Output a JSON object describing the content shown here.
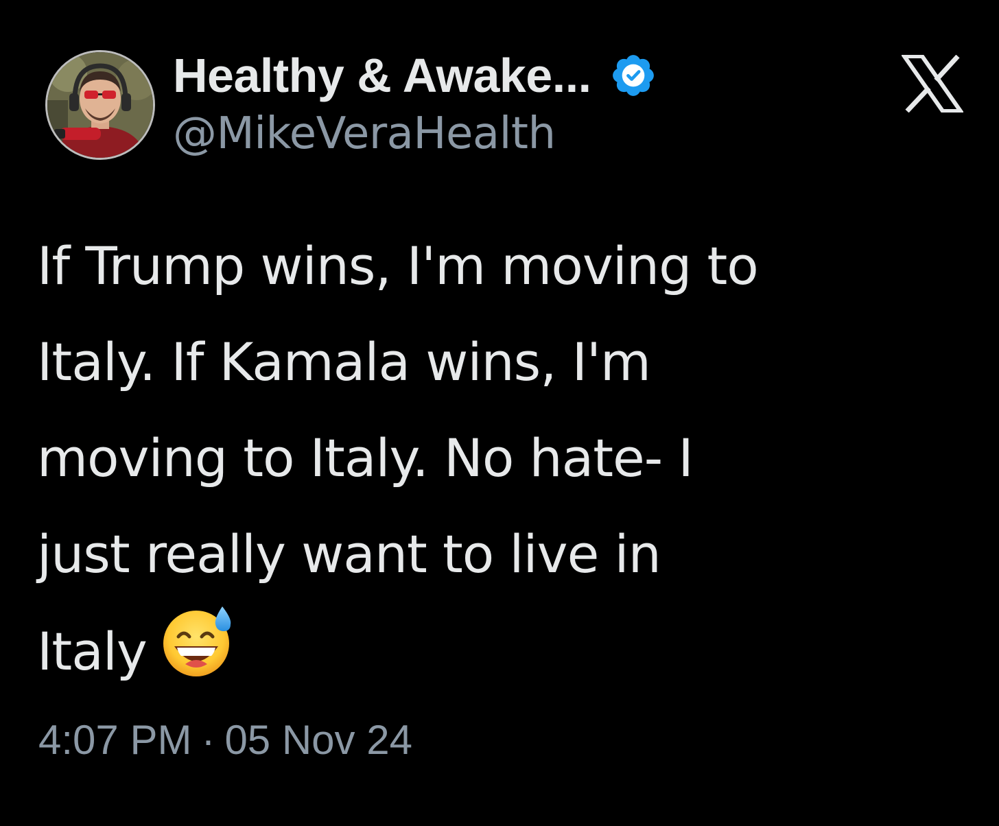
{
  "tweet": {
    "author": {
      "display_name": "Healthy & Awake...",
      "handle": "@MikeVeraHealth",
      "verified": true,
      "avatar_icon": "profile-photo"
    },
    "platform_icon": "x-logo-icon",
    "text_lines": [
      "If Trump wins, I'm moving to",
      "Italy. If Kamala wins, I'm",
      "moving to Italy. No hate- I",
      "just really want to live in",
      "Italy"
    ],
    "emoji_icon": "grinning-sweat-emoji",
    "time": "4:07 PM",
    "separator": "·",
    "date": "05 Nov 24"
  },
  "colors": {
    "background": "#000000",
    "primary_text": "#e7e9ea",
    "secondary_text": "#8b98a5",
    "verified_badge": "#1d9bf0"
  }
}
